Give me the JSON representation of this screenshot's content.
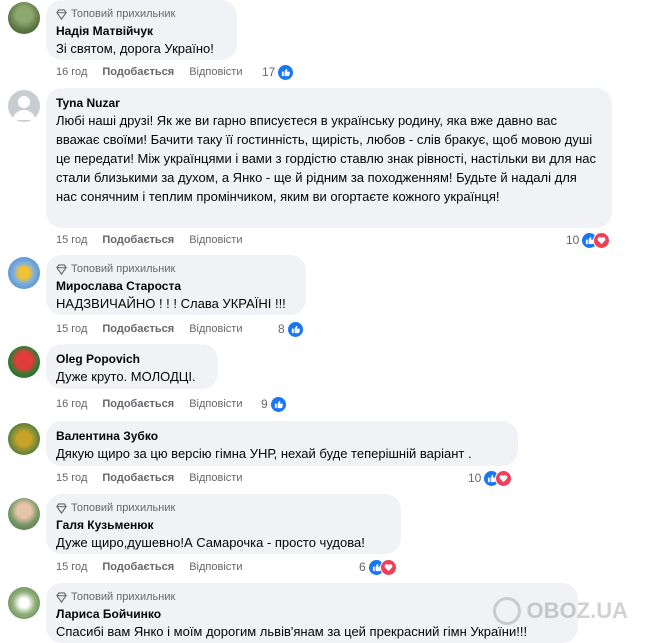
{
  "badge_label": "Топовий прихильник",
  "like_label": "Подобається",
  "reply_label": "Відповісти",
  "colors": {
    "like": "#1877f2",
    "love": "#f33e58",
    "bubble": "#f0f2f5",
    "meta": "#65676b"
  },
  "comments": [
    {
      "name": "Надія Матвійчук",
      "badge": true,
      "text": "Зі святом, дорога Україно!",
      "time": "16 год",
      "reactions": "17",
      "reaction_types": [
        "like"
      ]
    },
    {
      "name": "Tyna Nuzar",
      "badge": false,
      "text": "Любі наші друзі! Як же ви гарно вписуєтеся в українську родину, яка вже давно вас вважає своїми! Бачити таку її гостинність, щирість, любов - слів бракує, щоб мовою душі це передати! Між українцями і вами з гордістю ставлю знак рівності, настільки ви для нас стали близькими за духом, а Янко - ще й рідним за походженням! Будьте й надалі для нас сонячним і теплим промінчиком, яким ви огортаєте кожного українця!",
      "time": "15 год",
      "reactions": "10",
      "reaction_types": [
        "like",
        "love"
      ]
    },
    {
      "name": "Мирослава Староста",
      "badge": true,
      "text": "НАДЗВИЧАЙНО ! ! ! Слава УКРАЇНІ !!!",
      "time": "15 год",
      "reactions": "8",
      "reaction_types": [
        "like"
      ]
    },
    {
      "name": "Oleg Popovich",
      "badge": false,
      "text": "Дуже круто. МОЛОДЦІ.",
      "time": "16 год",
      "reactions": "9",
      "reaction_types": [
        "like"
      ]
    },
    {
      "name": "Валентина Зубко",
      "badge": false,
      "text": "Дякую щиро за цю версію гімна УНР, нехай буде теперішній варіант .",
      "time": "15 год",
      "reactions": "10",
      "reaction_types": [
        "like",
        "love"
      ]
    },
    {
      "name": "Галя Кузьменюк",
      "badge": true,
      "text": "Дуже щиро,душевно!А Самарочка - просто чудова!",
      "time": "15 год",
      "reactions": "6",
      "reaction_types": [
        "like",
        "love"
      ]
    },
    {
      "name": "Лариса Бойчинко",
      "badge": true,
      "text": "Спасибі вам Янко і моїм дорогим львів'янам за цей прекрасний гімн України!!!",
      "time": "",
      "reactions": "",
      "reaction_types": []
    }
  ],
  "watermark": "OBOZ.UA"
}
